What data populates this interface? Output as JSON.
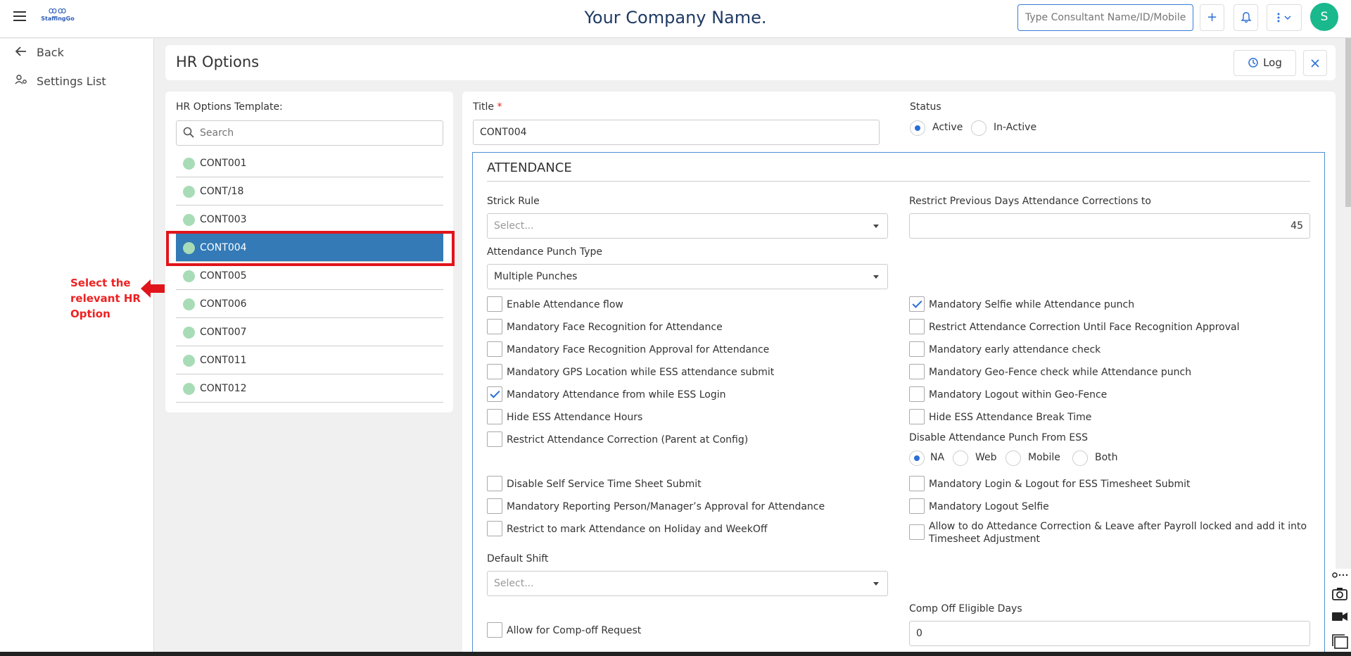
{
  "topbar": {
    "logo_text": "StaffingGo",
    "company_name": "Your Company Name.",
    "search_placeholder": "Type Consultant Name/ID/Mobile/...",
    "add_label": "+",
    "avatar_initial": "S"
  },
  "sidebar": {
    "items": [
      {
        "icon": "back-arrow-icon",
        "label": "Back"
      },
      {
        "icon": "settings-users-icon",
        "label": "Settings List"
      }
    ]
  },
  "annotation": {
    "text": "Select the relevant HR Option",
    "color": "#e0151b"
  },
  "header": {
    "title": "HR Options",
    "log_label": "Log"
  },
  "templates": {
    "label": "HR Options Template:",
    "search_placeholder": "Search",
    "selected": "CONT004",
    "items": [
      "CONT001",
      "CONT/18",
      "CONT003",
      "CONT004",
      "CONT005",
      "CONT006",
      "CONT007",
      "CONT011",
      "CONT012"
    ]
  },
  "form": {
    "title_label": "Title",
    "required_mark": "*",
    "title_value": "CONT004",
    "status_label": "Status",
    "status_options": [
      "Active",
      "In-Active"
    ],
    "status_selected": "Active"
  },
  "attendance": {
    "section_title": "ATTENDANCE",
    "strick_rule_label": "Strick Rule",
    "strick_rule_placeholder": "Select...",
    "restrict_days_label": "Restrict Previous Days Attendance Corrections to",
    "restrict_days_value": "45",
    "punch_type_label": "Attendance Punch Type",
    "punch_type_value": "Multiple Punches",
    "checkboxes_left": [
      {
        "label": "Enable Attendance flow",
        "checked": false
      },
      {
        "label": "Mandatory Face Recognition for Attendance",
        "checked": false
      },
      {
        "label": "Mandatory Face Recognition Approval for Attendance",
        "checked": false
      },
      {
        "label": "Mandatory GPS Location while ESS attendance submit",
        "checked": false
      },
      {
        "label": "Mandatory Attendance from while ESS Login",
        "checked": true
      },
      {
        "label": "Hide ESS Attendance Hours",
        "checked": false
      },
      {
        "label": "Restrict Attendance Correction (Parent at Config)",
        "checked": false
      }
    ],
    "checkboxes_right": [
      {
        "label": "Mandatory Selfie while Attendance punch",
        "checked": true
      },
      {
        "label": "Restrict Attendance Correction Until Face Recognition Approval",
        "checked": false
      },
      {
        "label": "Mandatory early attendance check",
        "checked": false
      },
      {
        "label": "Mandatory Geo-Fence check while Attendance punch",
        "checked": false
      },
      {
        "label": "Mandatory Logout within Geo-Fence",
        "checked": false
      },
      {
        "label": "Hide ESS Attendance Break Time",
        "checked": false
      }
    ],
    "disable_punch_label": "Disable Attendance Punch From ESS",
    "disable_punch_options": [
      "NA",
      "Web",
      "Mobile",
      "Both"
    ],
    "disable_punch_selected": "NA",
    "checkboxes_left2": [
      {
        "label": "Disable Self Service Time Sheet Submit",
        "checked": false
      },
      {
        "label": "Mandatory Reporting Person/Manager’s Approval for Attendance",
        "checked": false
      },
      {
        "label": "Restrict to mark Attendance on Holiday and WeekOff",
        "checked": false
      }
    ],
    "checkboxes_right2": [
      {
        "label": "Mandatory Login & Logout for ESS Timesheet Submit",
        "checked": false
      },
      {
        "label": "Mandatory Logout Selfie",
        "checked": false
      },
      {
        "label": "Allow to do Attedance Correction & Leave after Payroll locked and add it into Timesheet Adjustment",
        "checked": false
      }
    ],
    "default_shift_label": "Default Shift",
    "default_shift_placeholder": "Select...",
    "comp_off_request_label": "Allow for Comp-off Request",
    "comp_off_request_checked": false,
    "comp_off_days_label": "Comp Off Eligible Days",
    "comp_off_days_value": "0"
  },
  "colors": {
    "accent": "#2a6fd6",
    "selected_row": "#337ab7",
    "avatar": "#19b88d",
    "dot": "#a8dcb6",
    "annotation": "#e0151b"
  }
}
